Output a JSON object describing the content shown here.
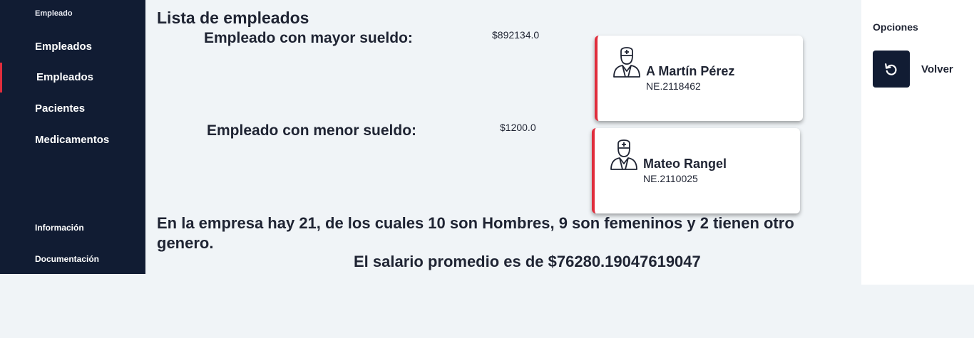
{
  "sidebar": {
    "section_employee": "Empleado",
    "items": [
      {
        "label": "Empleados"
      },
      {
        "label": "Empleados"
      },
      {
        "label": "Pacientes"
      },
      {
        "label": "Medicamentos"
      }
    ],
    "section_info": "Información",
    "documentation": "Documentación"
  },
  "main": {
    "title": "Lista de empleados",
    "highest_label": "Empleado con mayor sueldo:",
    "highest_salary": "$892134.0",
    "lowest_label": "Empleado con menor sueldo:",
    "lowest_salary": "$1200.0",
    "highest_card": {
      "name": "A Martín Pérez",
      "code": "NE.2118462",
      "icon": "doctor-icon"
    },
    "lowest_card": {
      "name": "Mateo Rangel",
      "code": "NE.2110025",
      "icon": "doctor-icon"
    },
    "summary": "En la empresa hay 21, de los cuales 10 son Hombres, 9 son femeninos y 2 tienen otro genero.",
    "average": "El salario promedio es de $76280.19047619047"
  },
  "options": {
    "title": "Opciones",
    "back_label": "Volver",
    "back_icon": "undo-icon"
  },
  "colors": {
    "sidebar_bg": "#111c33",
    "accent": "#e02d3c",
    "page_bg": "#f0f4f7"
  }
}
